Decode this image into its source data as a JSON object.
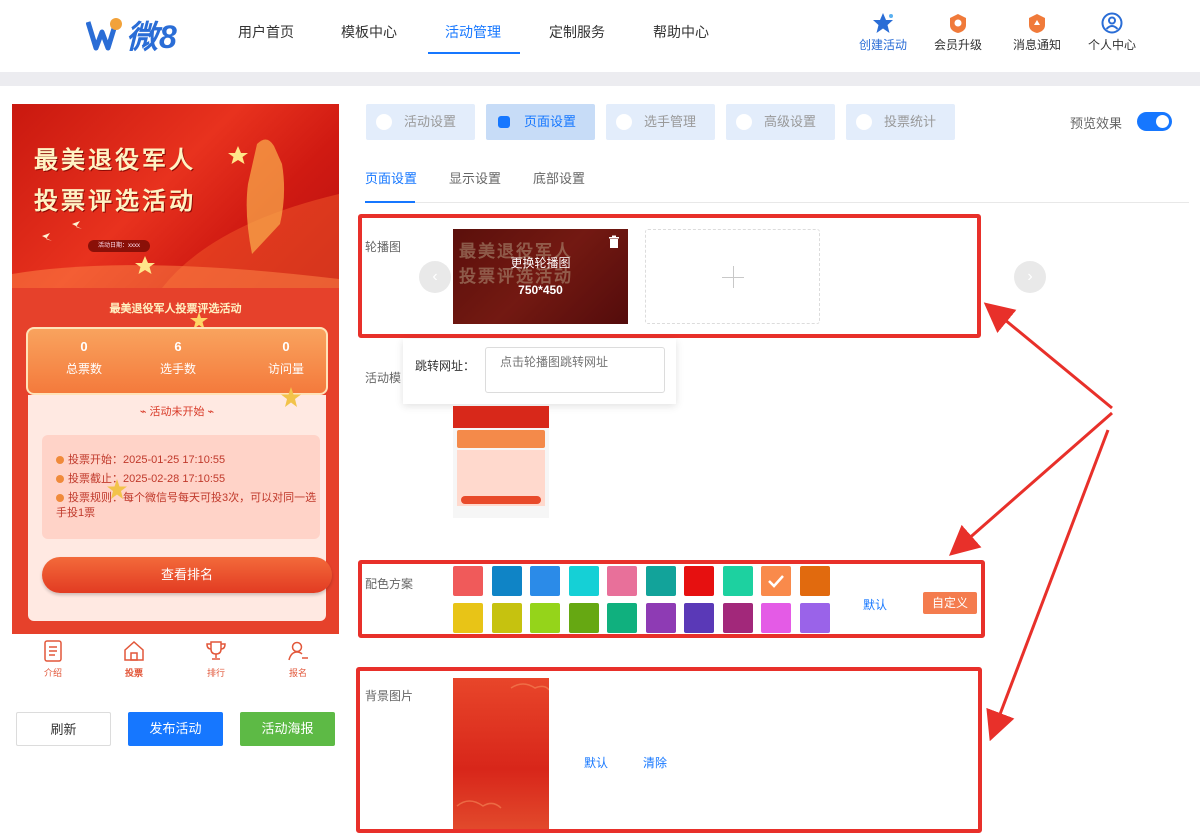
{
  "header": {
    "logo_text": "微8",
    "nav": [
      "用户首页",
      "模板中心",
      "活动管理",
      "定制服务",
      "帮助中心"
    ],
    "actions": [
      {
        "label": "创建活动",
        "icon": "star-icon"
      },
      {
        "label": "会员升级",
        "icon": "vip-badge-icon"
      },
      {
        "label": "消息通知",
        "icon": "bell-badge-icon"
      },
      {
        "label": "个人中心",
        "icon": "user-icon"
      }
    ]
  },
  "preview": {
    "banner_line1": "最美退役军人",
    "banner_line2": "投票评选活动",
    "banner_date": "活动日期：xxxx",
    "activity_title": "最美退役军人投票评选活动",
    "stats": [
      {
        "value": "0",
        "label": "总票数"
      },
      {
        "value": "6",
        "label": "选手数"
      },
      {
        "value": "0",
        "label": "访问量"
      }
    ],
    "status": "活动未开始",
    "vote_start": "投票开始：2025-01-25 17:10:55",
    "vote_end": "投票截止：2025-02-28 17:10:55",
    "vote_rule": "投票规则：每个微信号每天可投3次，可以对同一选手投1票",
    "rank_button": "查看排名",
    "tabbar": [
      "介绍",
      "投票",
      "排行",
      "报名"
    ]
  },
  "bottom_buttons": {
    "refresh": "刷新",
    "publish": "发布活动",
    "poster": "活动海报"
  },
  "settings_tabs": [
    "活动设置",
    "页面设置",
    "选手管理",
    "高级设置",
    "投票统计"
  ],
  "preview_toggle_label": "预览效果",
  "sub_tabs": [
    "页面设置",
    "显示设置",
    "底部设置"
  ],
  "sections": {
    "carousel": "轮播图",
    "template": "活动模",
    "colors": "配色方案",
    "background": "背景图片"
  },
  "carousel": {
    "change_text": "更换轮播图",
    "size": "750*450"
  },
  "jump": {
    "label": "跳转网址：",
    "placeholder": "点击轮播图跳转网址"
  },
  "color_scheme": {
    "row1": [
      "#f05a5a",
      "#0f84c6",
      "#2b8be8",
      "#15d0d6",
      "#e8709a",
      "#12a39a",
      "#e61010",
      "#1dd1a0",
      "#f98a4b",
      "#e16a0e"
    ],
    "row2": [
      "#e8c417",
      "#c6c20f",
      "#95d41a",
      "#66a812",
      "#10b07e",
      "#8e3bb4",
      "#5a39b7",
      "#a2287a",
      "#e45be6",
      "#9a63e9"
    ],
    "selected": "#f98a4b",
    "default_label": "默认",
    "custom_label": "自定义"
  },
  "background": {
    "default_label": "默认",
    "clear_label": "清除"
  }
}
